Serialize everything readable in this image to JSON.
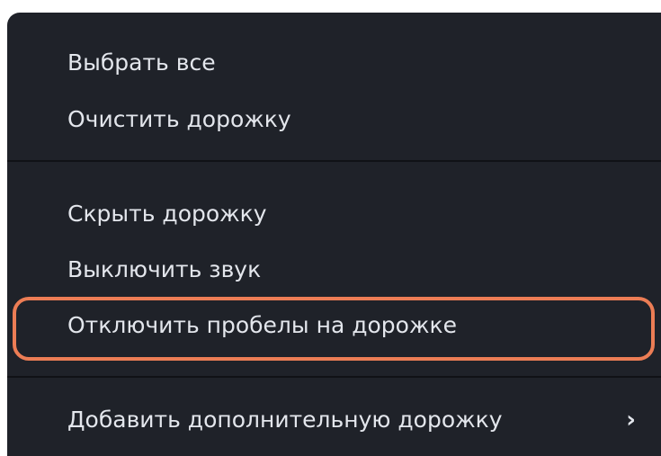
{
  "context_menu": {
    "items": [
      {
        "label": "Выбрать все"
      },
      {
        "label": "Очистить дорожку"
      },
      {
        "label": "Скрыть дорожку"
      },
      {
        "label": "Выключить звук"
      },
      {
        "label": "Отключить пробелы на дорожке",
        "highlighted": true
      },
      {
        "label": "Добавить дополнительную дорожку",
        "submenu_glyph": "›"
      }
    ],
    "highlight_color": "#ec7d55",
    "background_color": "#1f2229",
    "text_color": "#e3e6ec",
    "submenu_icon": "chevron-right-icon"
  }
}
